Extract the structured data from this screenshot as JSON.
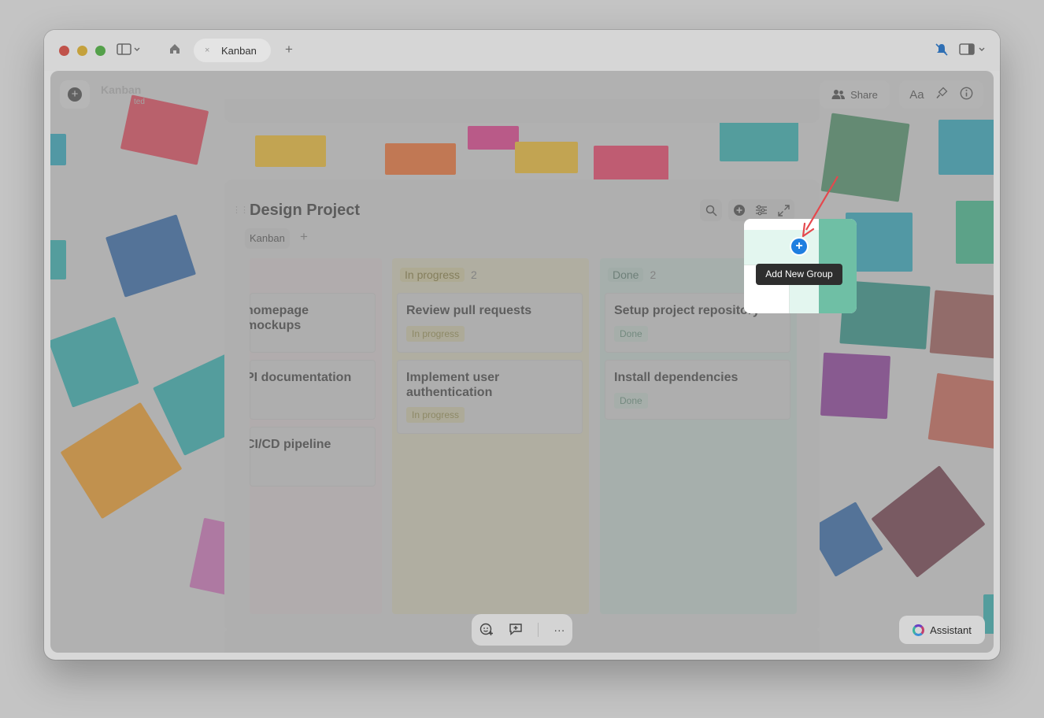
{
  "window": {
    "tab_label": "Kanban",
    "tab_close": "×",
    "new_tab": "+"
  },
  "header": {
    "doc_title": "Kanban",
    "doc_subtitle": "ted",
    "share_label": "Share",
    "font_label": "Aa"
  },
  "board": {
    "title": "Design Project",
    "view_tab": "Kanban",
    "view_add": "+",
    "columns": [
      {
        "name": "",
        "count": "",
        "cards": [
          {
            "title": "homepage mockups",
            "tag": ""
          },
          {
            "title": "PI documentation",
            "tag": ""
          },
          {
            "title": "CI/CD pipeline",
            "tag": ""
          }
        ]
      },
      {
        "name": "In progress",
        "count": "2",
        "cards": [
          {
            "title": "Review pull requests",
            "tag": "In progress"
          },
          {
            "title": "Implement user authentication",
            "tag": "In progress"
          }
        ]
      },
      {
        "name": "Done",
        "count": "2",
        "cards": [
          {
            "title": "Setup project repository",
            "tag": "Done"
          },
          {
            "title": "Install dependencies",
            "tag": "Done"
          }
        ]
      }
    ]
  },
  "spotlight": {
    "tooltip": "Add New Group",
    "button": "+"
  },
  "footer": {
    "assistant_label": "Assistant",
    "more": "···"
  },
  "colors": {
    "accent_blue": "#1f7ee0",
    "arrow_red": "#e5484d",
    "in_progress_badge": "#f5e6a8",
    "done_badge": "#d4efe4"
  }
}
